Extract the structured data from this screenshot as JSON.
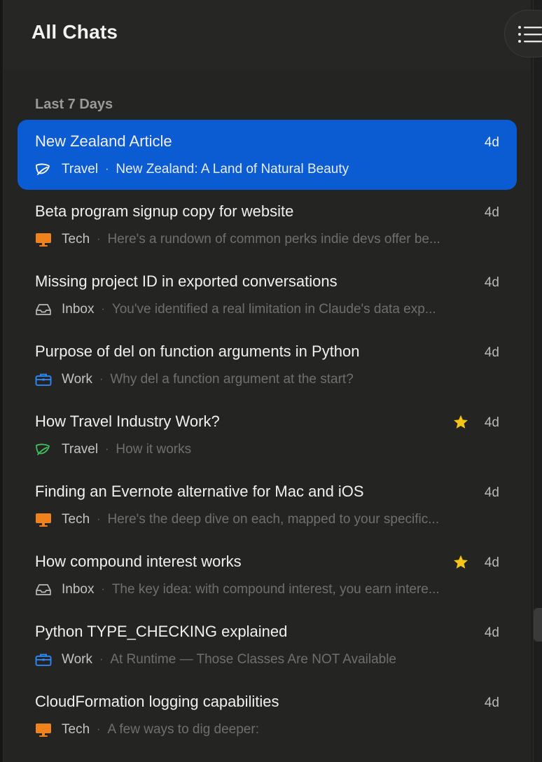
{
  "header": {
    "title": "All Chats",
    "menu_icon": "list-icon"
  },
  "section": {
    "label": "Last 7 Days"
  },
  "colors": {
    "selected": "#0b5bd3",
    "travel": "#3fbf5f",
    "tech": "#f0821e",
    "inbox": "#b9b9b7",
    "work": "#2f8cff",
    "star": "#f5c518"
  },
  "chats": [
    {
      "title": "New Zealand Article",
      "age": "4d",
      "category": "Travel",
      "icon": "leaf-icon",
      "preview": "New Zealand: A Land of Natural Beauty",
      "starred": false,
      "selected": true
    },
    {
      "title": "Beta program signup copy for website",
      "age": "4d",
      "category": "Tech",
      "icon": "monitor-icon",
      "preview": "Here's a rundown of common perks indie devs offer be...",
      "starred": false,
      "selected": false
    },
    {
      "title": "Missing project ID in exported conversations",
      "age": "4d",
      "category": "Inbox",
      "icon": "inbox-icon",
      "preview": "You've identified a real limitation in Claude's data exp...",
      "starred": false,
      "selected": false
    },
    {
      "title": "Purpose of del on function arguments in Python",
      "age": "4d",
      "category": "Work",
      "icon": "briefcase-icon",
      "preview": "Why del a function argument at the start?",
      "starred": false,
      "selected": false
    },
    {
      "title": "How Travel Industry Work?",
      "age": "4d",
      "category": "Travel",
      "icon": "leaf-icon",
      "preview": "How it works",
      "starred": true,
      "selected": false
    },
    {
      "title": "Finding an Evernote alternative for Mac and iOS",
      "age": "4d",
      "category": "Tech",
      "icon": "monitor-icon",
      "preview": "Here's the deep dive on each, mapped to your specific...",
      "starred": false,
      "selected": false
    },
    {
      "title": "How compound interest works",
      "age": "4d",
      "category": "Inbox",
      "icon": "inbox-icon",
      "preview": "The key idea: with compound interest, you earn intere...",
      "starred": true,
      "selected": false
    },
    {
      "title": "Python TYPE_CHECKING explained",
      "age": "4d",
      "category": "Work",
      "icon": "briefcase-icon",
      "preview": "At Runtime — Those Classes Are NOT Available",
      "starred": false,
      "selected": false
    },
    {
      "title": "CloudFormation logging capabilities",
      "age": "4d",
      "category": "Tech",
      "icon": "monitor-icon",
      "preview": "A few ways to dig deeper:",
      "starred": false,
      "selected": false
    }
  ]
}
